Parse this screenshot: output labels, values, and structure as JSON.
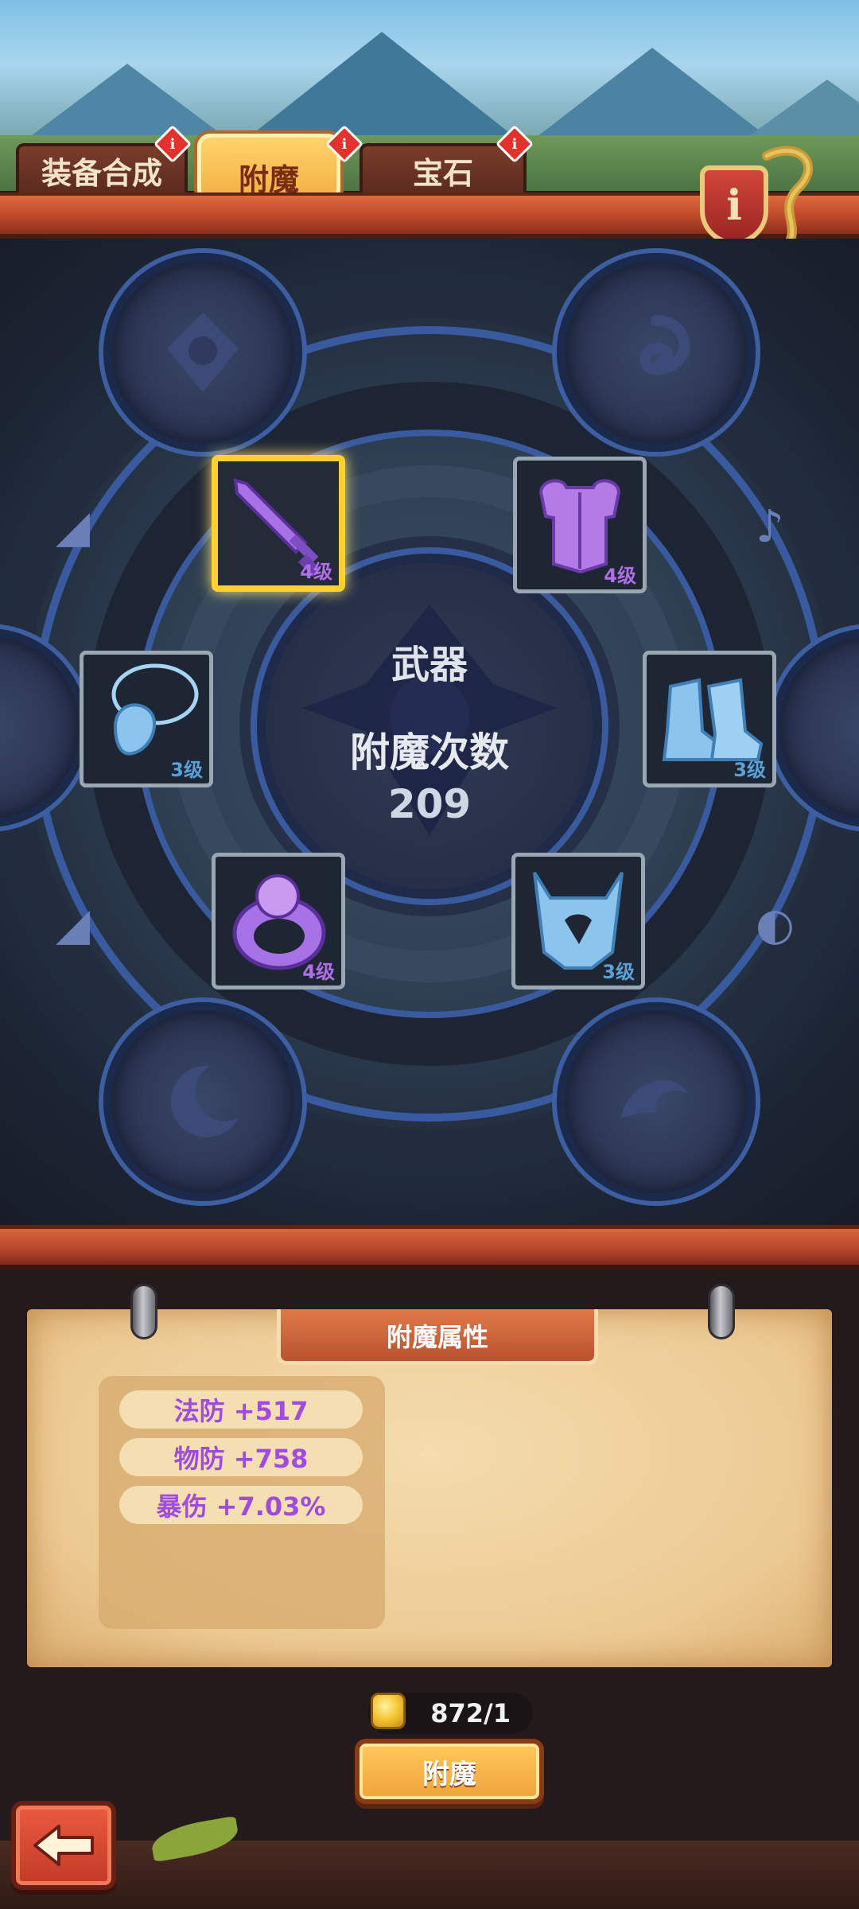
{
  "tabs": [
    {
      "label": "装备合成",
      "badge": "i",
      "active": false
    },
    {
      "label": "附魔",
      "badge": "i",
      "active": true
    },
    {
      "label": "宝石",
      "badge": "i",
      "active": false
    }
  ],
  "info_button": {
    "label": "i",
    "icon": "info-shield-icon"
  },
  "center": {
    "slot_name": "武器",
    "count_label": "附魔次数",
    "count_value": "209"
  },
  "equipment": [
    {
      "name": "weapon",
      "icon": "sword-icon",
      "level": "4级",
      "selected": true,
      "color": "#b06ee8"
    },
    {
      "name": "armor",
      "icon": "chest-armor-icon",
      "level": "4级",
      "selected": false,
      "color": "#b06ee8"
    },
    {
      "name": "amulet",
      "icon": "amulet-icon",
      "level": "3级",
      "selected": false,
      "color": "#5aa0d8"
    },
    {
      "name": "boots",
      "icon": "boots-icon",
      "level": "3级",
      "selected": false,
      "color": "#5aa0d8"
    },
    {
      "name": "ring",
      "icon": "ring-icon",
      "level": "4级",
      "selected": false,
      "color": "#b06ee8"
    },
    {
      "name": "helmet",
      "icon": "helmet-icon",
      "level": "3级",
      "selected": false,
      "color": "#5aa0d8"
    }
  ],
  "properties": {
    "title": "附魔属性",
    "stats": [
      "法防 +517",
      "物防 +758",
      "暴伤 +7.03%"
    ]
  },
  "cost": {
    "icon": "gold-coin-icon",
    "value": "872/1"
  },
  "enchant_button": {
    "label": "附魔"
  },
  "back_button": {
    "icon": "back-arrow-icon"
  },
  "colors": {
    "purple_tier": "#b06ee8",
    "blue_tier": "#5aa0d8",
    "selected_border": "#ffd02e",
    "stat_text": "#a04be0"
  }
}
